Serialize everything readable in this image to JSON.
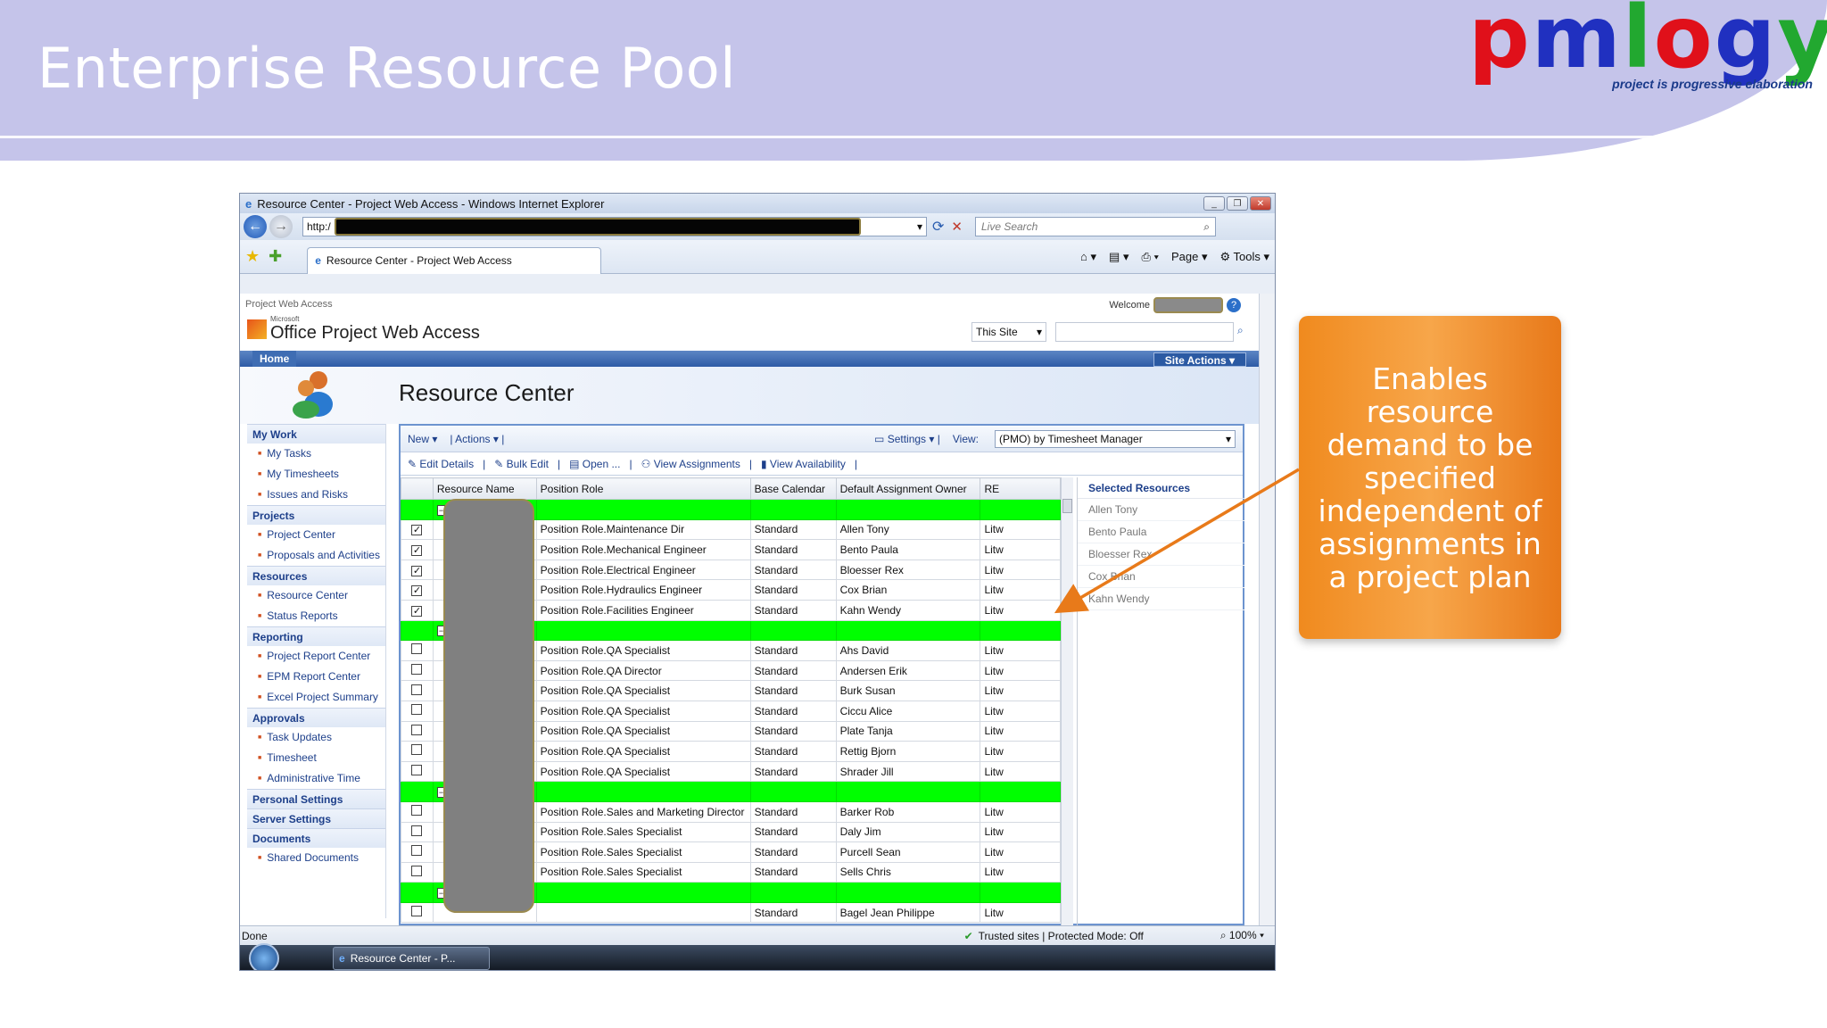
{
  "slide": {
    "title": "Enterprise Resource Pool",
    "logo_text": "pmlogy",
    "logo_tagline": "project is progressive elaboration",
    "callout_lines": [
      "Enables",
      "resource",
      "demand to be",
      "specified",
      "independent of",
      "assignments in",
      "a project plan"
    ]
  },
  "browser": {
    "window_title": "Resource Center - Project Web Access - Windows Internet Explorer",
    "url_prefix": "http:/",
    "search_placeholder": "Live Search",
    "tab_label": "Resource Center - Project Web Access",
    "toolbar": {
      "page": "Page",
      "tools": "Tools"
    },
    "status_left": "Done",
    "status_zone": "Trusted sites | Protected Mode: Off",
    "zoom": "100%",
    "taskbar_item": "Resource Center - P..."
  },
  "pwa": {
    "top_label": "Project Web Access",
    "welcome": "Welcome",
    "brand_small": "Microsoft",
    "brand": "Office Project Web Access",
    "this_site": "This Site",
    "home_tab": "Home",
    "site_actions": "Site Actions",
    "page_title": "Resource Center"
  },
  "leftnav": [
    {
      "head": "My Work",
      "items": [
        "My Tasks",
        "My Timesheets",
        "Issues and Risks"
      ]
    },
    {
      "head": "Projects",
      "items": [
        "Project Center",
        "Proposals and Activities"
      ]
    },
    {
      "head": "Resources",
      "items": [
        "Resource Center",
        "Status Reports"
      ]
    },
    {
      "head": "Reporting",
      "items": [
        "Project Report Center",
        "EPM Report Center",
        "Excel Project Summary"
      ]
    },
    {
      "head": "Approvals",
      "items": [
        "Task Updates",
        "Timesheet",
        "Administrative Time"
      ]
    },
    {
      "head": "Personal Settings",
      "items": []
    },
    {
      "head": "Server Settings",
      "items": []
    },
    {
      "head": "Documents",
      "items": [
        "Shared Documents"
      ]
    }
  ],
  "grid_toolbar": {
    "new": "New",
    "actions": "Actions",
    "settings": "Settings",
    "view_label": "View:",
    "view_value": "(PMO) by Timesheet Manager",
    "edit_details": "Edit Details",
    "bulk_edit": "Bulk Edit",
    "open": "Open ...",
    "view_assignments": "View Assignments",
    "view_availability": "View Availability"
  },
  "columns": [
    "",
    "Resource Name",
    "Position Role",
    "Base Calendar",
    "Default Assignment Owner",
    "RE"
  ],
  "rows": [
    {
      "group": true
    },
    {
      "checked": true,
      "role": "Position Role.Maintenance Dir",
      "cal": "Standard",
      "owner": "Allen Tony",
      "re": "Litw"
    },
    {
      "checked": true,
      "role": "Position Role.Mechanical Engineer",
      "cal": "Standard",
      "owner": "Bento Paula",
      "re": "Litw"
    },
    {
      "checked": true,
      "role": "Position Role.Electrical Engineer",
      "cal": "Standard",
      "owner": "Bloesser Rex",
      "re": "Litw"
    },
    {
      "checked": true,
      "role": "Position Role.Hydraulics Engineer",
      "cal": "Standard",
      "owner": "Cox Brian",
      "re": "Litw"
    },
    {
      "checked": true,
      "role": "Position Role.Facilities Engineer",
      "cal": "Standard",
      "owner": "Kahn Wendy",
      "re": "Litw"
    },
    {
      "group": true
    },
    {
      "checked": false,
      "role": "Position Role.QA Specialist",
      "cal": "Standard",
      "owner": "Ahs David",
      "re": "Litw"
    },
    {
      "checked": false,
      "role": "Position Role.QA Director",
      "cal": "Standard",
      "owner": "Andersen Erik",
      "re": "Litw"
    },
    {
      "checked": false,
      "role": "Position Role.QA Specialist",
      "cal": "Standard",
      "owner": "Burk Susan",
      "re": "Litw"
    },
    {
      "checked": false,
      "role": "Position Role.QA Specialist",
      "cal": "Standard",
      "owner": "Ciccu Alice",
      "re": "Litw"
    },
    {
      "checked": false,
      "role": "Position Role.QA Specialist",
      "cal": "Standard",
      "owner": "Plate Tanja",
      "re": "Litw"
    },
    {
      "checked": false,
      "role": "Position Role.QA Specialist",
      "cal": "Standard",
      "owner": "Rettig Bjorn",
      "re": "Litw"
    },
    {
      "checked": false,
      "role": "Position Role.QA Specialist",
      "cal": "Standard",
      "owner": "Shrader Jill",
      "re": "Litw"
    },
    {
      "group": true
    },
    {
      "checked": false,
      "role": "Position Role.Sales and Marketing Director",
      "cal": "Standard",
      "owner": "Barker Rob",
      "re": "Litw"
    },
    {
      "checked": false,
      "role": "Position Role.Sales Specialist",
      "cal": "Standard",
      "owner": "Daly Jim",
      "re": "Litw"
    },
    {
      "checked": false,
      "role": "Position Role.Sales Specialist",
      "cal": "Standard",
      "owner": "Purcell Sean",
      "re": "Litw"
    },
    {
      "checked": false,
      "role": "Position Role.Sales Specialist",
      "cal": "Standard",
      "owner": "Sells Chris",
      "re": "Litw"
    },
    {
      "group": true
    },
    {
      "checked": false,
      "role": "",
      "cal": "Standard",
      "owner": "Bagel Jean Philippe",
      "re": "Litw"
    }
  ],
  "selected_panel": {
    "title": "Selected Resources",
    "items": [
      "Allen Tony",
      "Bento Paula",
      "Bloesser Rex",
      "Cox Brian",
      "Kahn Wendy"
    ]
  },
  "colors": {
    "header_bg": "#c5c4ea",
    "group_row": "#00ff00",
    "callout": "#f08a1e",
    "logo_p": "#e0101a",
    "logo_m": "#2030c0",
    "logo_l": "#22a830",
    "logo_o": "#e0101a",
    "logo_g": "#2030c0",
    "logo_y": "#22a830"
  }
}
